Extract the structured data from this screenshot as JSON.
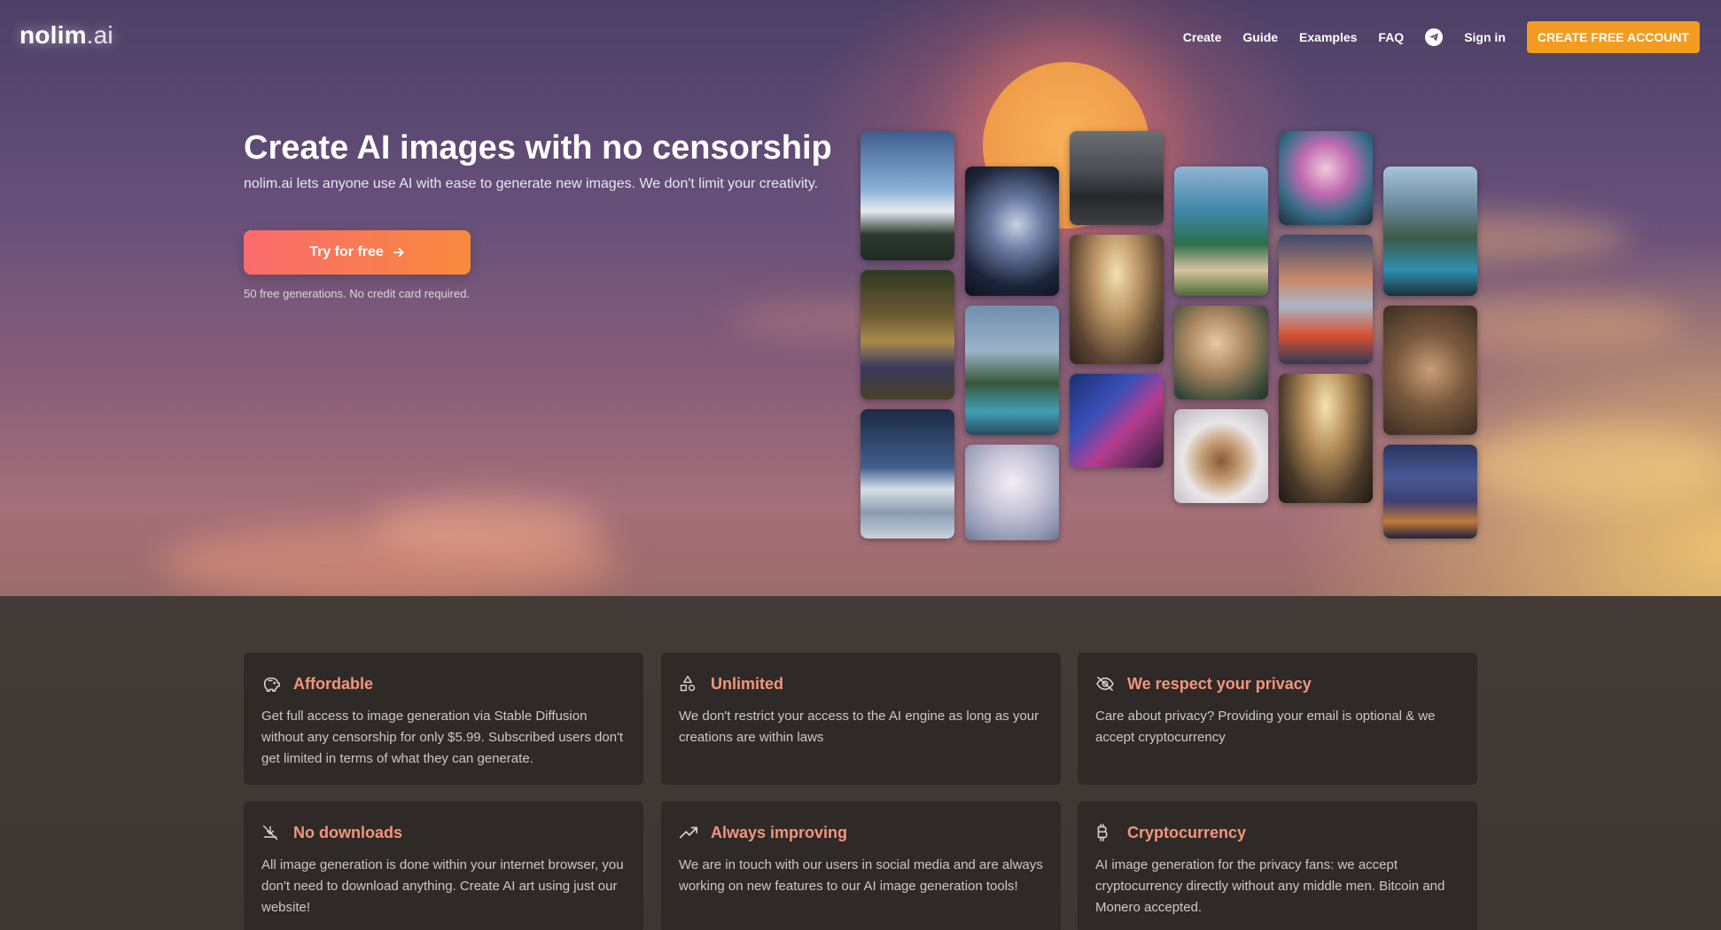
{
  "brand": {
    "name": "nolim",
    "tld": ".ai"
  },
  "nav": {
    "links": [
      "Create",
      "Guide",
      "Examples",
      "FAQ"
    ],
    "signin": "Sign in",
    "cta": "CREATE FREE ACCOUNT"
  },
  "hero": {
    "title": "Create AI images with no censorship",
    "subtitle": "nolim.ai lets anyone use AI with ease to generate new images. We don't limit your creativity.",
    "button": "Try for free",
    "note": "50 free generations. No credit card required."
  },
  "gallery": {
    "images": [
      "mountain-sunrise",
      "monkey-family-portrait",
      "snowy-mountains-night",
      "robot-woman",
      "modern-glass-house",
      "white-haired-woman",
      "man-in-city",
      "luxury-hotel-lobby",
      "cyberpunk-bearded-man",
      "mediterranean-villa",
      "renaissance-woman",
      "bunny-hat-dog",
      "pink-haired-girl",
      "red-mountain-sunset",
      "grand-hallway",
      "villa-pool",
      "monkey-group",
      "futuristic-city"
    ]
  },
  "features": [
    {
      "icon": "piggy-bank-icon",
      "title": "Affordable",
      "text": "Get full access to image generation via Stable Diffusion without any censorship for only $5.99. Subscribed users don't get limited in terms of what they can generate."
    },
    {
      "icon": "shapes-icon",
      "title": "Unlimited",
      "text": "We don't restrict your access to the AI engine as long as your creations are within laws"
    },
    {
      "icon": "eye-off-icon",
      "title": "We respect your privacy",
      "text": "Care about privacy? Providing your email is optional & we accept cryptocurrency"
    },
    {
      "icon": "download-off-icon",
      "title": "No downloads",
      "text": "All image generation is done within your internet browser, you don't need to download anything. Create AI art using just our website!"
    },
    {
      "icon": "trending-up-icon",
      "title": "Always improving",
      "text": "We are in touch with our users in social media and are always working on new features to our AI image generation tools!"
    },
    {
      "icon": "bitcoin-icon",
      "title": "Cryptocurrency",
      "text": "AI image generation for the privacy fans: we accept cryptocurrency directly without any middle men. Bitcoin and Monero accepted."
    }
  ],
  "colors": {
    "accent_orange": "#f39c1f",
    "feature_title": "#f3957d",
    "card_bg": "#2f2a27"
  }
}
